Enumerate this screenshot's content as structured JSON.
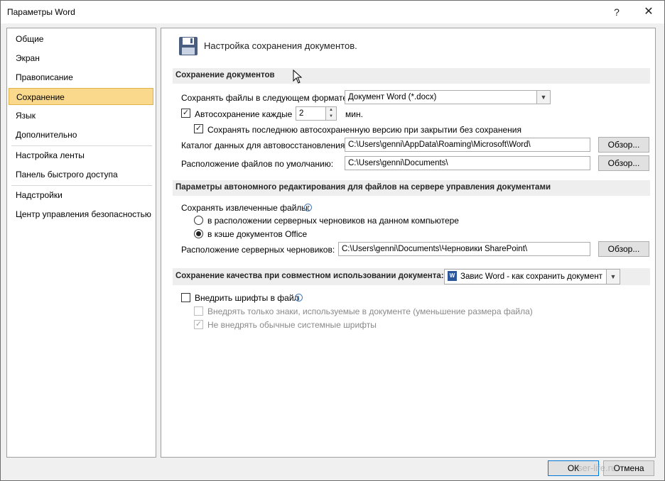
{
  "window": {
    "title": "Параметры Word",
    "help": "?",
    "close": "✕"
  },
  "nav": [
    "Общие",
    "Экран",
    "Правописание",
    "Сохранение",
    "Язык",
    "Дополнительно",
    "Настройка ленты",
    "Панель быстрого доступа",
    "Надстройки",
    "Центр управления безопасностью"
  ],
  "selected_nav": "Сохранение",
  "header": {
    "title": "Настройка сохранения документов."
  },
  "save_section": {
    "title": "Сохранение документов",
    "format_label": "Сохранять файлы в следующем формате:",
    "format_value": "Документ Word (*.docx)",
    "autosave_label": "Автосохранение каждые",
    "autosave_value": "2",
    "autosave_unit": "мин.",
    "autosave_checked": true,
    "keep_last_label": "Сохранять последнюю автосохраненную версию при закрытии без сохранения",
    "keep_last_checked": true,
    "autorecover_label": "Каталог данных для автовосстановления:",
    "autorecover_path": "C:\\Users\\genni\\AppData\\Roaming\\Microsoft\\Word\\",
    "default_label": "Расположение файлов по умолчанию:",
    "default_path": "C:\\Users\\genni\\Documents\\",
    "browse": "Обзор..."
  },
  "offline_section": {
    "title": "Параметры автономного редактирования для файлов на сервере управления документами",
    "save_checked_label": "Сохранять извлеченные файлы:",
    "radio_1": "в расположении серверных черновиков на данном компьютере",
    "radio_2": "в кэше документов Office",
    "selected_radio": 2,
    "drafts_label": "Расположение серверных черновиков:",
    "drafts_path": "C:\\Users\\genni\\Documents\\Черновики SharePoint\\",
    "browse": "Обзор..."
  },
  "quality_section": {
    "title": "Сохранение качества при совместном использовании документа:",
    "doc_value": "Завис Word - как сохранить документ",
    "embed_fonts_label": "Внедрить шрифты в файл",
    "embed_fonts_checked": false,
    "embed_only_used_label": "Внедрять только знаки, используемые в документе (уменьшение размера файла)",
    "embed_only_used_checked": false,
    "no_common_label": "Не внедрять обычные системные шрифты",
    "no_common_checked": true
  },
  "footer": {
    "ok": "ОК",
    "cancel": "Отмена"
  },
  "watermark": "ser-life.ru",
  "colors": {
    "selection_bg": "#fad98c",
    "selection_border": "#e0b24e",
    "section_bg": "#eeeeee"
  }
}
